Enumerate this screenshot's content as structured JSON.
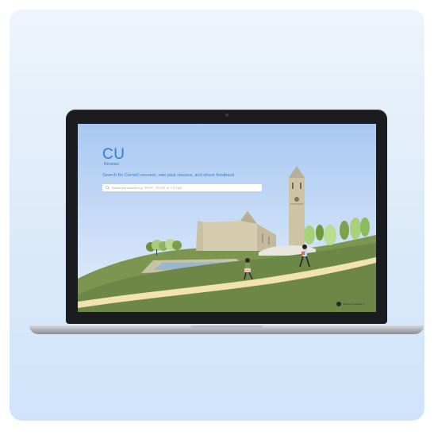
{
  "app": {
    "brand_mark": "CU",
    "brand_sub": "Reviews",
    "tagline": "Search for Cornell courses, rate past classes, and share feedback",
    "search": {
      "placeholder": "Search any keyword e.g. \"PHYS\", \"ECON\" or \"CS 2110\""
    },
    "footer_badge": "Powered by Cornell DTI"
  },
  "colors": {
    "accent": "#2b7ee4",
    "sky": "#b9d3f4",
    "grass": "#6f8a45",
    "path": "#f2e2b0"
  },
  "icons": {
    "search": "search-icon"
  }
}
